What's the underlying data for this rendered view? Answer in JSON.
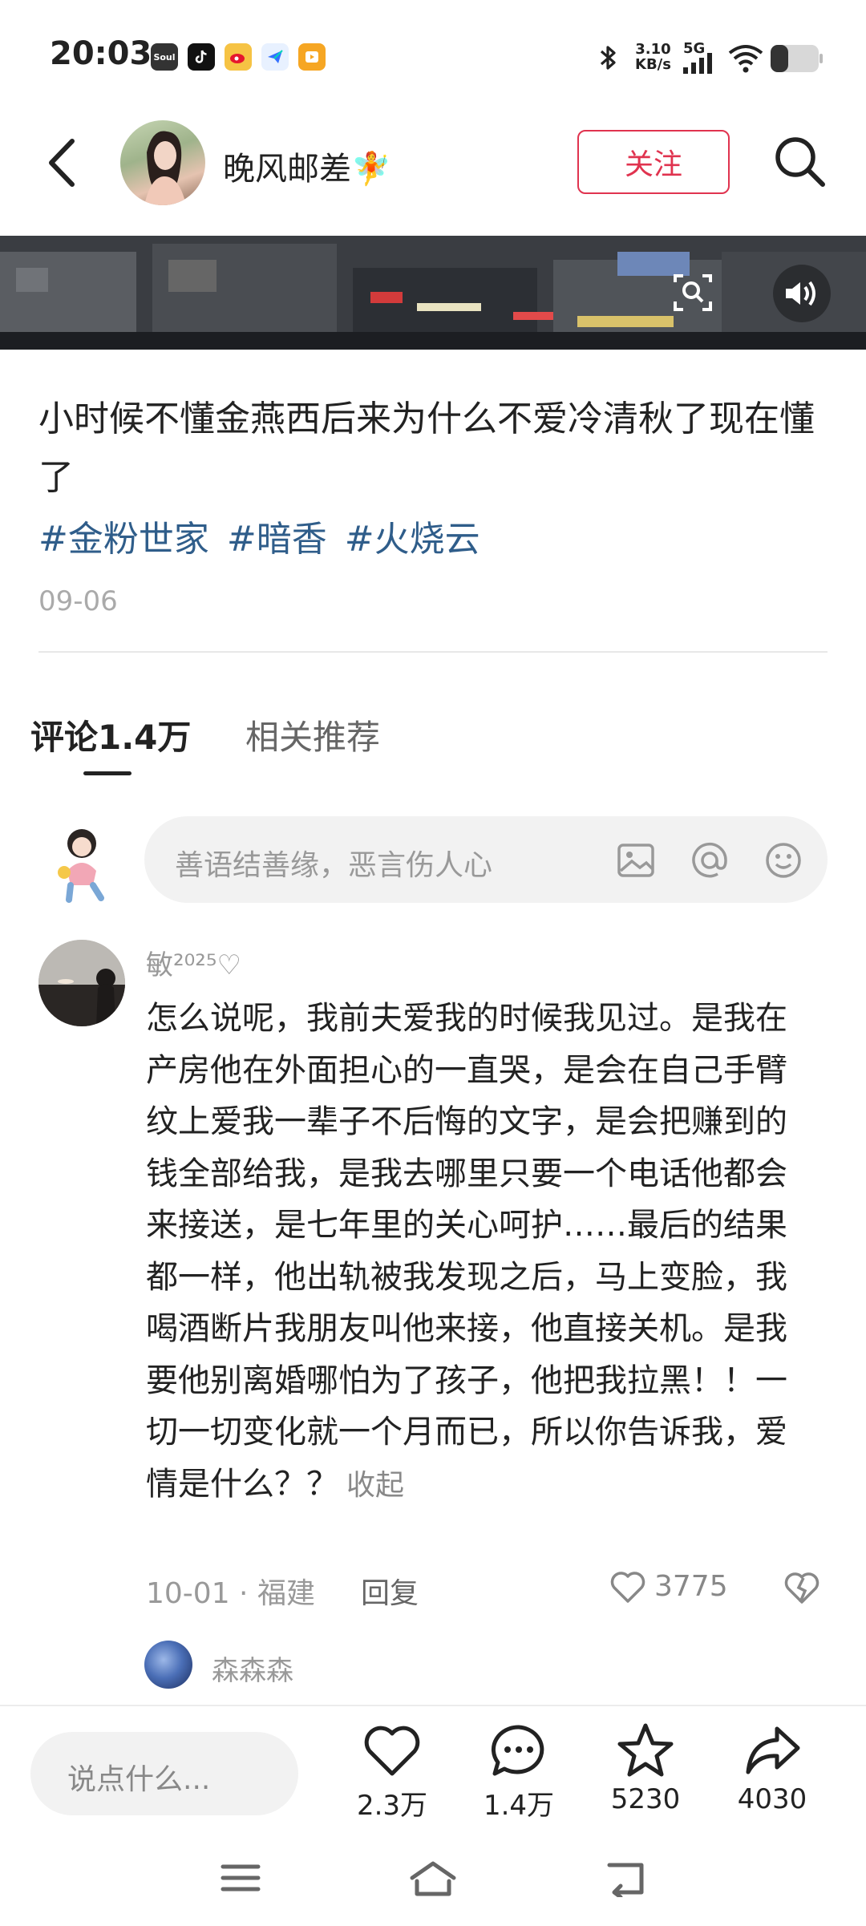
{
  "status_bar": {
    "time": "20:03",
    "apps": [
      "Soul",
      "抖音",
      "微博",
      "飞书",
      "播放"
    ],
    "net_speed_value": "3.10",
    "net_speed_unit": "KB/s",
    "network": "5G"
  },
  "header": {
    "author_name": "晚风邮差🧚",
    "follow_label": "关注"
  },
  "post": {
    "text": "小时候不懂金燕西后来为什么不爱冷清秋了现在懂了",
    "tags": [
      "#金粉世家",
      "#暗香",
      "#火烧云"
    ],
    "date": "09-06"
  },
  "tabs": {
    "comments": "评论1.4万",
    "related": "相关推荐"
  },
  "comment_input": {
    "placeholder": "善语结善缘，恶言伤人心"
  },
  "comment": {
    "user": "敏²⁰²⁵♡",
    "text": "怎么说呢，我前夫爱我的时候我见过。是我在产房他在外面担心的一直哭，是会在自己手臂纹上爱我一辈子不后悔的文字，是会把赚到的钱全部给我，是我去哪里只要一个电话他都会来接送，是七年里的关心呵护……最后的结果都一样，他出轨被我发现之后，马上变脸，我喝酒断片我朋友叫他来接，他直接关机。是我要他别离婚哪怕为了孩子，他把我拉黑！！一切一切变化就一个月而已，所以你告诉我，爱情是什么？？",
    "collapse_label": "收起",
    "meta": "10-01 · 福建",
    "reply_label": "回复",
    "likes": "3775"
  },
  "reply": {
    "user": "森森森"
  },
  "bottom_bar": {
    "say_placeholder": "说点什么...",
    "likes": "2.3万",
    "comments": "1.4万",
    "favorites": "5230",
    "shares": "4030"
  }
}
